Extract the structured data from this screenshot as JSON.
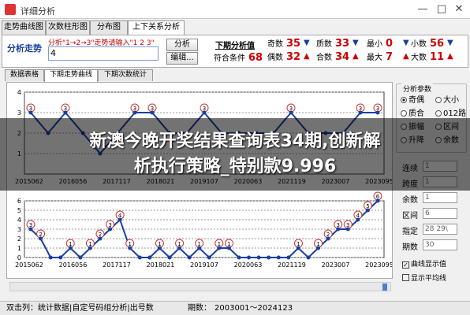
{
  "window": {
    "title": "详细分析",
    "min": "—",
    "max": "□",
    "close": "✕"
  },
  "top_tabs": [
    "走势曲线图",
    "次数柱形图",
    "分布图",
    "上下关系分析"
  ],
  "control": {
    "mode_label": "分析走势",
    "hint": "分析\"1→2→3\"走势请输入\"1 2 3\"",
    "input_value": "4",
    "analyze_button": "分析",
    "edit_button": "编辑...",
    "header_next": "下期分析值",
    "header_match": "符合条件",
    "match_value": "68",
    "stats": [
      {
        "label": "奇数",
        "value": "35",
        "arrow": "down"
      },
      {
        "label": "质数",
        "value": "33",
        "arrow": "down"
      },
      {
        "label": "最小",
        "value": "0",
        "arrow": "down"
      },
      {
        "label": "小数",
        "value": "56",
        "arrow": "down"
      },
      {
        "label": "偶数",
        "value": "32",
        "arrow": "up"
      },
      {
        "label": "合数",
        "value": "34",
        "arrow": "up"
      },
      {
        "label": "最大",
        "value": "7",
        "arrow": "up"
      },
      {
        "label": "大数",
        "value": "11",
        "arrow": "up"
      }
    ]
  },
  "sub_tabs": [
    "数据表格",
    "下期走势曲线",
    "下期次数统计"
  ],
  "chart_data": [
    {
      "type": "line",
      "x_ticks": [
        "2015062",
        "2016056",
        "2017117",
        "2018021",
        "2019107",
        "2020063",
        "2021119",
        "2023007",
        "2023095"
      ],
      "y_ticks": [
        1,
        2,
        3,
        4
      ],
      "ylim": [
        0,
        4
      ],
      "y_values_visible": [
        3,
        2,
        3,
        2,
        1,
        2,
        3,
        3,
        2,
        2,
        3,
        2,
        2,
        2,
        2,
        3,
        2,
        2,
        2,
        3,
        3
      ]
    },
    {
      "type": "line",
      "x_ticks": [
        "2015062",
        "2016056",
        "2017117",
        "2018021",
        "2019107",
        "2020063",
        "2021119",
        "2023007",
        "2023095"
      ],
      "y_ticks": [
        0,
        1,
        2,
        3,
        4,
        5,
        6
      ],
      "ylim": [
        0,
        6
      ],
      "y_values": [
        3,
        2,
        0,
        0,
        1,
        0,
        1,
        2,
        3,
        4,
        1,
        0,
        0,
        1,
        0,
        1,
        0,
        1,
        0,
        1,
        1,
        0,
        0,
        0,
        0,
        0,
        0,
        1,
        0,
        1,
        2,
        3,
        3,
        4,
        5,
        6
      ]
    }
  ],
  "settings": {
    "group_title": "分析参数",
    "radios": [
      {
        "label": "奇偶",
        "on": true
      },
      {
        "label": "大小",
        "on": false
      },
      {
        "label": "质合",
        "on": false
      },
      {
        "label": "012路",
        "on": false
      },
      {
        "label": "振幅",
        "on": false
      },
      {
        "label": "区间",
        "on": false
      },
      {
        "label": "升降",
        "on": false
      },
      {
        "label": "余数",
        "on": false
      }
    ],
    "fields": [
      {
        "label": "连续",
        "value": "1"
      },
      {
        "label": "跨度",
        "value": "1"
      },
      {
        "label": "余数",
        "value": "1"
      },
      {
        "label": "区间",
        "value": "6"
      },
      {
        "label": "指定",
        "value": "28 29\\"
      },
      {
        "label": "期数",
        "value": "30"
      }
    ],
    "checks": [
      {
        "label": "曲线显示值",
        "on": true
      },
      {
        "label": "显示平均线",
        "on": false
      }
    ]
  },
  "status": {
    "left": "双击列：统计数据|自定号码组分析|出号数",
    "range_label": "期数：",
    "range_value": "2003001～2024123"
  },
  "overlay": {
    "line1": "新澳今晚开奖结果查询表34期,创新解",
    "line2": "析执行策略_特别款9.996"
  }
}
